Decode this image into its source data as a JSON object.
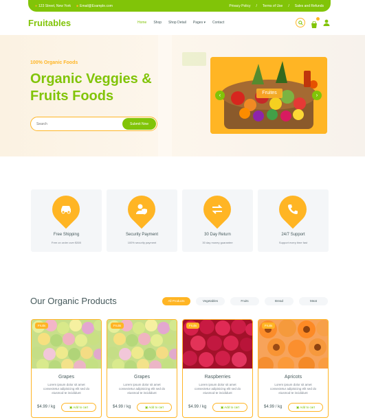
{
  "topbar": {
    "address": "123 Street, New York",
    "email": "Email@Example.com",
    "links": [
      "Privacy Policy",
      "Terms of Use",
      "Sales and Refunds"
    ],
    "separator": "/"
  },
  "navbar": {
    "brand": "Fruitables",
    "items": [
      {
        "label": "Home",
        "active": true
      },
      {
        "label": "Shop",
        "active": false
      },
      {
        "label": "Shop Detail",
        "active": false
      },
      {
        "label": "Pages",
        "active": false
      },
      {
        "label": "Contact",
        "active": false
      }
    ],
    "icons": [
      "search-icon",
      "shopping-bag-icon",
      "user-icon"
    ]
  },
  "hero": {
    "kicker": "100% Organic Foods",
    "title": "Organic Veggies & Fruits Foods",
    "search_placeholder": "Search",
    "search_button": "Submit Now",
    "carousel_label": "Fruites",
    "carousel_prev": "‹",
    "carousel_next": "›"
  },
  "features": [
    {
      "title": "Free Shipping",
      "subtitle": "Free on order over $300",
      "icon": "car-icon"
    },
    {
      "title": "Security Payment",
      "subtitle": "100% security payment",
      "icon": "user-shield-icon"
    },
    {
      "title": "30 Day Return",
      "subtitle": "30 day money guarantee",
      "icon": "exchange-icon"
    },
    {
      "title": "24/7 Support",
      "subtitle": "Support every time fast",
      "icon": "phone-icon"
    }
  ],
  "products": {
    "title": "Our Organic Products",
    "tabs": [
      {
        "label": "All Products",
        "active": true
      },
      {
        "label": "Vegetables",
        "active": false
      },
      {
        "label": "Fruits",
        "active": false
      },
      {
        "label": "Bread",
        "active": false
      },
      {
        "label": "Meat",
        "active": false
      }
    ],
    "items": [
      {
        "tag": "Fruits",
        "name": "Grapes",
        "desc": "Lorem ipsum dolor sit amet consectetur adipisicing elit sed do eiusmod te incididunt",
        "price": "$4.99 / kg",
        "cart": "Add to cart"
      },
      {
        "tag": "Fruits",
        "name": "Grapes",
        "desc": "Lorem ipsum dolor sit amet consectetur adipisicing elit sed do eiusmod te incididunt",
        "price": "$4.99 / kg",
        "cart": "Add to cart"
      },
      {
        "tag": "Fruits",
        "name": "Raspberries",
        "desc": "Lorem ipsum dolor sit amet consectetur adipisicing elit sed do eiusmod te incididunt",
        "price": "$4.99 / kg",
        "cart": "Add to cart"
      },
      {
        "tag": "Fruits",
        "name": "Apricots",
        "desc": "Lorem ipsum dolor sit amet consectetur adipisicing elit sed do eiusmod te incididunt",
        "price": "$4.99 / kg",
        "cart": "Add to cart"
      }
    ]
  },
  "colors": {
    "primary": "#81c408",
    "secondary": "#ffb524",
    "text": "#45595b",
    "muted": "#747d88",
    "light": "#f4f6f8"
  }
}
